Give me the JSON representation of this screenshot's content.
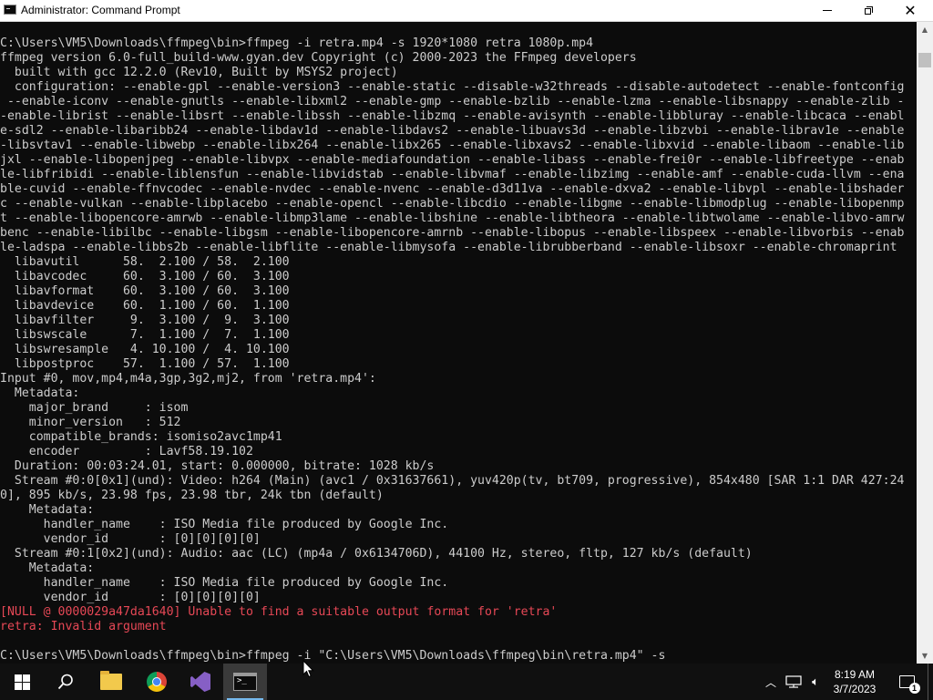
{
  "window": {
    "title": "Administrator: Command Prompt"
  },
  "console": {
    "lines": [
      "C:\\Users\\VM5\\Downloads\\ffmpeg\\bin>ffmpeg -i retra.mp4 -s 1920*1080 retra 1080p.mp4",
      "ffmpeg version 6.0-full_build-www.gyan.dev Copyright (c) 2000-2023 the FFmpeg developers",
      "  built with gcc 12.2.0 (Rev10, Built by MSYS2 project)",
      "  configuration: --enable-gpl --enable-version3 --enable-static --disable-w32threads --disable-autodetect --enable-fontconfig",
      " --enable-iconv --enable-gnutls --enable-libxml2 --enable-gmp --enable-bzlib --enable-lzma --enable-libsnappy --enable-zlib -",
      "-enable-librist --enable-libsrt --enable-libssh --enable-libzmq --enable-avisynth --enable-libbluray --enable-libcaca --enabl",
      "e-sdl2 --enable-libaribb24 --enable-libdav1d --enable-libdavs2 --enable-libuavs3d --enable-libzvbi --enable-librav1e --enable",
      "-libsvtav1 --enable-libwebp --enable-libx264 --enable-libx265 --enable-libxavs2 --enable-libxvid --enable-libaom --enable-lib",
      "jxl --enable-libopenjpeg --enable-libvpx --enable-mediafoundation --enable-libass --enable-frei0r --enable-libfreetype --enab",
      "le-libfribidi --enable-liblensfun --enable-libvidstab --enable-libvmaf --enable-libzimg --enable-amf --enable-cuda-llvm --ena",
      "ble-cuvid --enable-ffnvcodec --enable-nvdec --enable-nvenc --enable-d3d11va --enable-dxva2 --enable-libvpl --enable-libshader",
      "c --enable-vulkan --enable-libplacebo --enable-opencl --enable-libcdio --enable-libgme --enable-libmodplug --enable-libopenmp",
      "t --enable-libopencore-amrwb --enable-libmp3lame --enable-libshine --enable-libtheora --enable-libtwolame --enable-libvo-amrw",
      "benc --enable-libilbc --enable-libgsm --enable-libopencore-amrnb --enable-libopus --enable-libspeex --enable-libvorbis --enab",
      "le-ladspa --enable-libbs2b --enable-libflite --enable-libmysofa --enable-librubberband --enable-libsoxr --enable-chromaprint",
      "  libavutil      58.  2.100 / 58.  2.100",
      "  libavcodec     60.  3.100 / 60.  3.100",
      "  libavformat    60.  3.100 / 60.  3.100",
      "  libavdevice    60.  1.100 / 60.  1.100",
      "  libavfilter     9.  3.100 /  9.  3.100",
      "  libswscale      7.  1.100 /  7.  1.100",
      "  libswresample   4. 10.100 /  4. 10.100",
      "  libpostproc    57.  1.100 / 57.  1.100",
      "Input #0, mov,mp4,m4a,3gp,3g2,mj2, from 'retra.mp4':",
      "  Metadata:",
      "    major_brand     : isom",
      "    minor_version   : 512",
      "    compatible_brands: isomiso2avc1mp41",
      "    encoder         : Lavf58.19.102",
      "  Duration: 00:03:24.01, start: 0.000000, bitrate: 1028 kb/s",
      "  Stream #0:0[0x1](und): Video: h264 (Main) (avc1 / 0x31637661), yuv420p(tv, bt709, progressive), 854x480 [SAR 1:1 DAR 427:24",
      "0], 895 kb/s, 23.98 fps, 23.98 tbr, 24k tbn (default)",
      "    Metadata:",
      "      handler_name    : ISO Media file produced by Google Inc.",
      "      vendor_id       : [0][0][0][0]",
      "  Stream #0:1[0x2](und): Audio: aac (LC) (mp4a / 0x6134706D), 44100 Hz, stereo, fltp, 127 kb/s (default)",
      "    Metadata:",
      "      handler_name    : ISO Media file produced by Google Inc.",
      "      vendor_id       : [0][0][0][0]"
    ],
    "error_lines": [
      "[NULL @ 0000029a47da1640] Unable to find a suitable output format for 'retra'",
      "retra: Invalid argument"
    ],
    "prompt_line": "C:\\Users\\VM5\\Downloads\\ffmpeg\\bin>ffmpeg -i \"C:\\Users\\VM5\\Downloads\\ffmpeg\\bin\\retra.mp4\" -s"
  },
  "taskbar": {
    "apps": [
      "start",
      "search",
      "file-explorer",
      "google-chrome",
      "visual-studio",
      "command-prompt"
    ],
    "active_app": "command-prompt"
  },
  "tray": {
    "time": "8:19 AM",
    "date": "3/7/2023",
    "notification_count": "1"
  },
  "colors": {
    "console_bg": "#0c0c0c",
    "console_text": "#cccccc",
    "error_text": "#e74856",
    "taskbar_bg": "#101010"
  }
}
